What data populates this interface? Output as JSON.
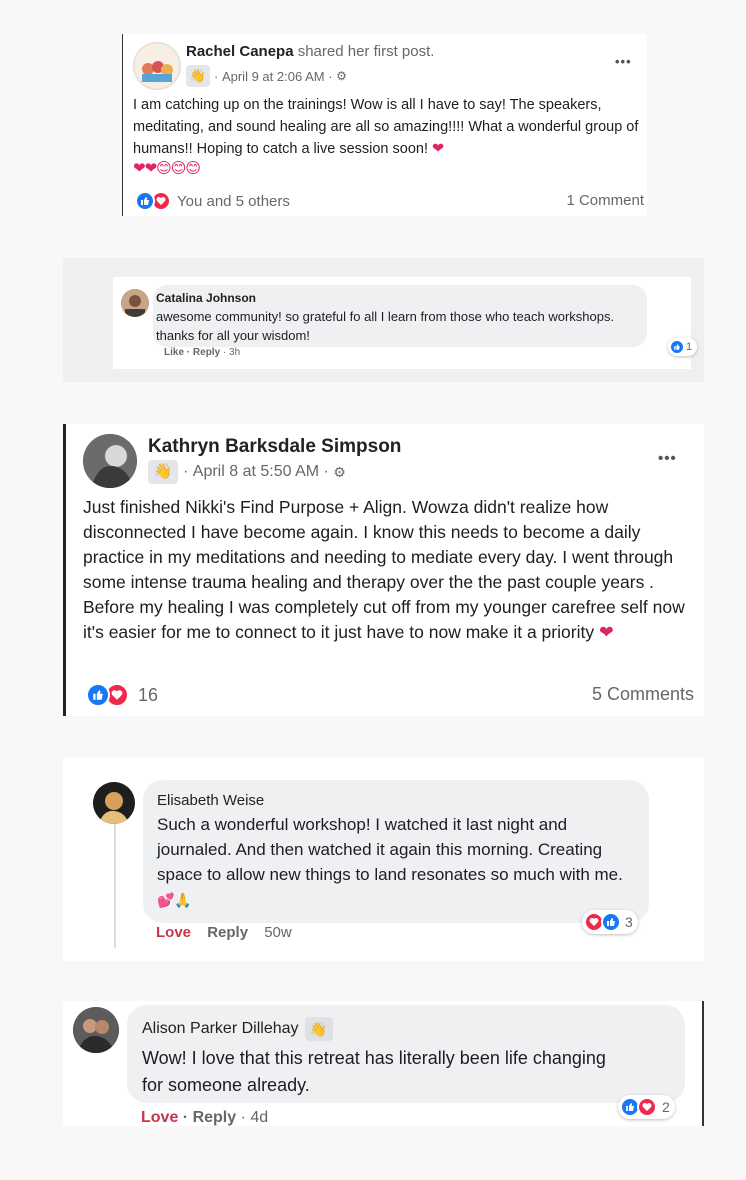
{
  "post1": {
    "author": "Rachel Canepa",
    "action": "shared her first post.",
    "wave_icon": "wave-icon",
    "date": "April 9 at 2:06 AM",
    "privacy_icon": "group-icon",
    "more": "•••",
    "text": "I am catching up on the trainings! Wow is all I have to say! The speakers, meditating, and sound healing are all so amazing!!!! What a wonderful group of humans!! Hoping to catch a live session soon!",
    "emojis": "❤❤😊😊😊",
    "reactions_text": "You and 5 others",
    "comments": "1 Comment"
  },
  "comment1": {
    "author": "Catalina Johnson",
    "text": "awesome community! so grateful fo all I learn from those who teach workshops. thanks for all your wisdom!",
    "like": "Like",
    "reply": "Reply",
    "time": "3h",
    "reaction_count": "1"
  },
  "post2": {
    "author": "Kathryn Barksdale Simpson",
    "date": "April 8 at 5:50 AM",
    "more": "•••",
    "text": "Just finished Nikki's Find Purpose + Align. Wowza didn't realize how disconnected I have become again. I know this needs to become a daily practice in my meditations and needing to mediate every day. I went through some intense trauma healing and therapy over the the past couple years . Before my healing I was completely cut off from my younger carefree self now it's easier for me to connect to it just have to now make it a priority",
    "reaction_count": "16",
    "comments": "5 Comments"
  },
  "comment2": {
    "author": "Elisabeth Weise",
    "text": "Such a wonderful workshop! I watched it last night and journaled. And then watched it again this morning. Creating space to allow new things to land resonates so much with me.",
    "emojis": "💕🙏",
    "love": "Love",
    "reply": "Reply",
    "time": "50w",
    "reaction_count": "3"
  },
  "comment3": {
    "author": "Alison Parker Dillehay",
    "text": "Wow! I love that this retreat has literally been life changing for someone already.",
    "love": "Love",
    "reply": "Reply",
    "time": "4d",
    "reaction_count": "2"
  },
  "colors": {
    "like_blue": "#1877f2",
    "love_red": "#f02849",
    "love_text": "#c9344a"
  }
}
